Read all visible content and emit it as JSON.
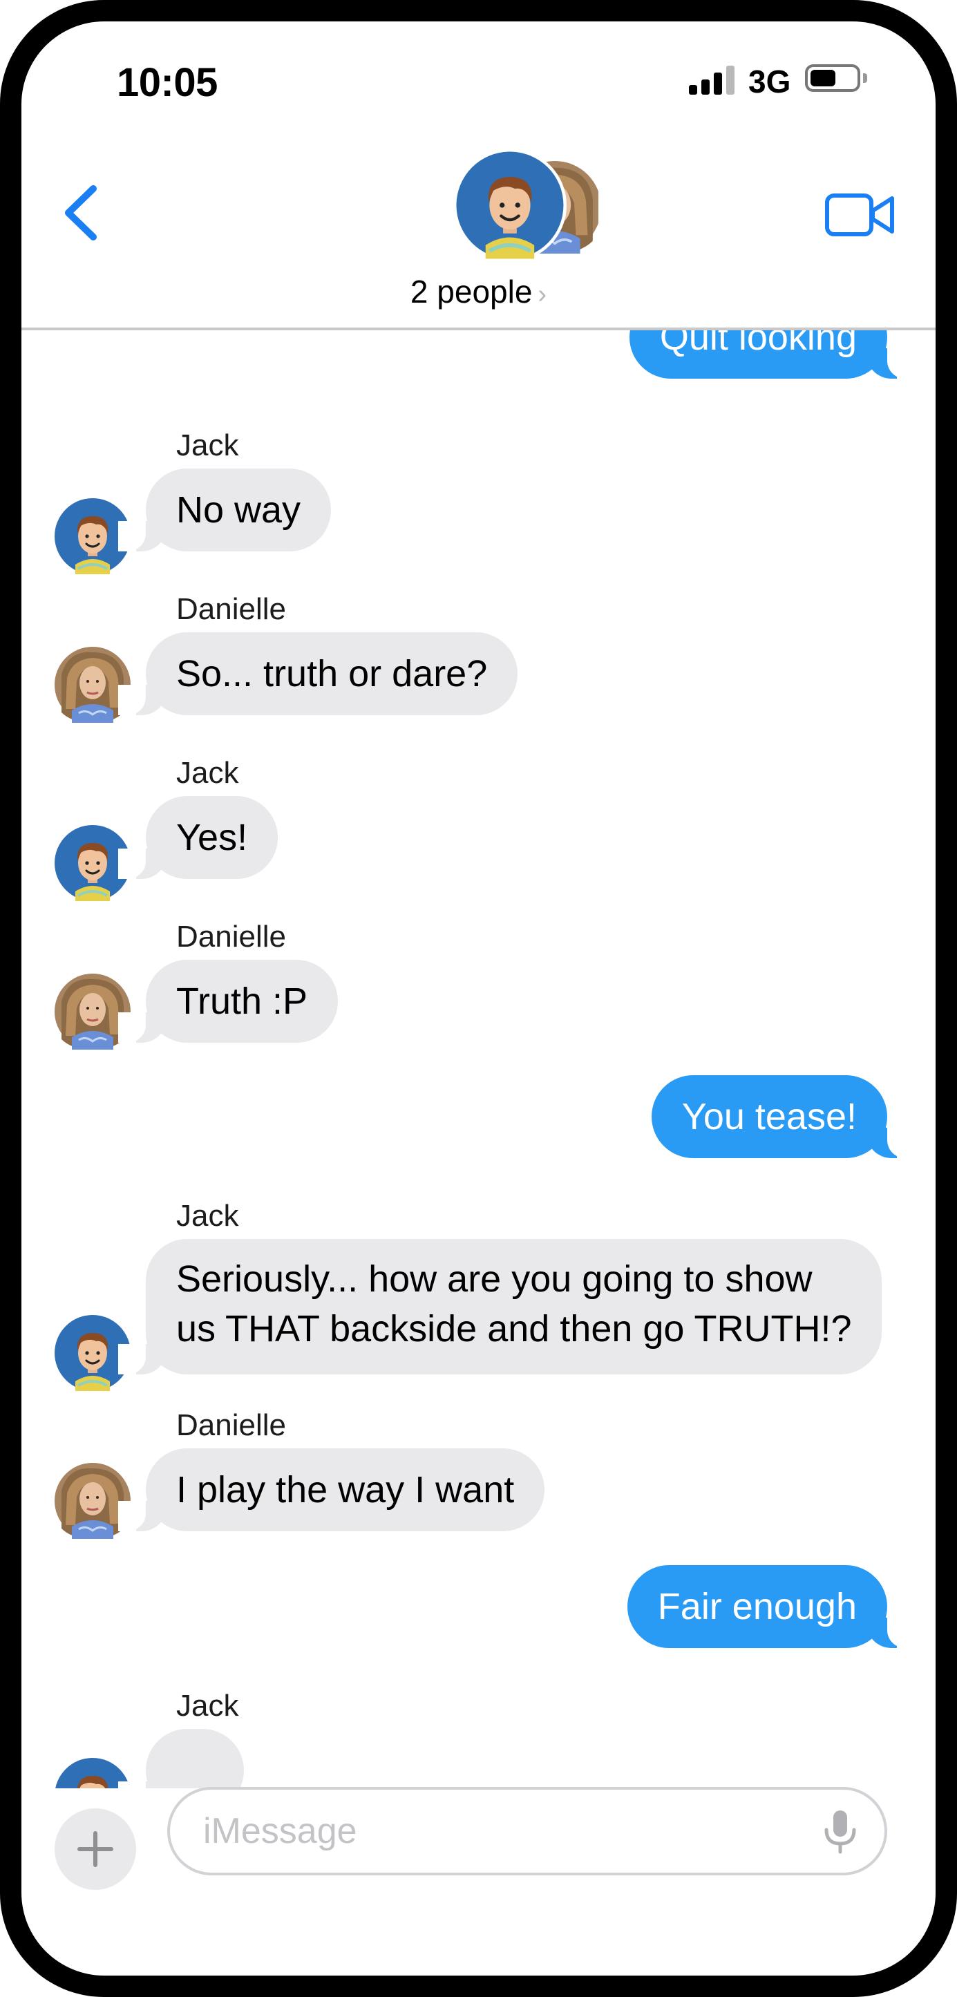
{
  "status_bar": {
    "time": "10:05",
    "network": "3G"
  },
  "header": {
    "group_label": "2 people",
    "chevron": "›"
  },
  "messages": [
    {
      "kind": "out",
      "text": "Quit looking"
    },
    {
      "kind": "in",
      "sender": "Jack",
      "text": "No way"
    },
    {
      "kind": "in",
      "sender": "Danielle",
      "text": "So... truth or dare?"
    },
    {
      "kind": "in",
      "sender": "Jack",
      "text": "Yes!"
    },
    {
      "kind": "in",
      "sender": "Danielle",
      "text": "Truth :P"
    },
    {
      "kind": "out",
      "text": "You tease!"
    },
    {
      "kind": "in",
      "sender": "Jack",
      "lines": [
        "Seriously... how are you going to show",
        "us THAT backside and then go TRUTH!?"
      ]
    },
    {
      "kind": "in",
      "sender": "Danielle",
      "text": "I play the way I want"
    },
    {
      "kind": "out",
      "text": "Fair enough"
    },
    {
      "kind": "in",
      "sender": "Jack",
      "text": ""
    }
  ],
  "input_bar": {
    "placeholder": "iMessage"
  },
  "icons": {
    "back": "chevron-left-icon",
    "video": "video-camera-icon",
    "plus": "plus-icon",
    "mic": "microphone-icon",
    "jack_avatar": "cartoon-boy-avatar",
    "danielle_avatar": "woman-photo-avatar"
  },
  "colors": {
    "accent": "#1a7ff2",
    "outgoing_bubble": "#2a9bf5",
    "incoming_bubble": "#e9e9eb",
    "jack_avatar_bg": "#2f6fb5"
  }
}
